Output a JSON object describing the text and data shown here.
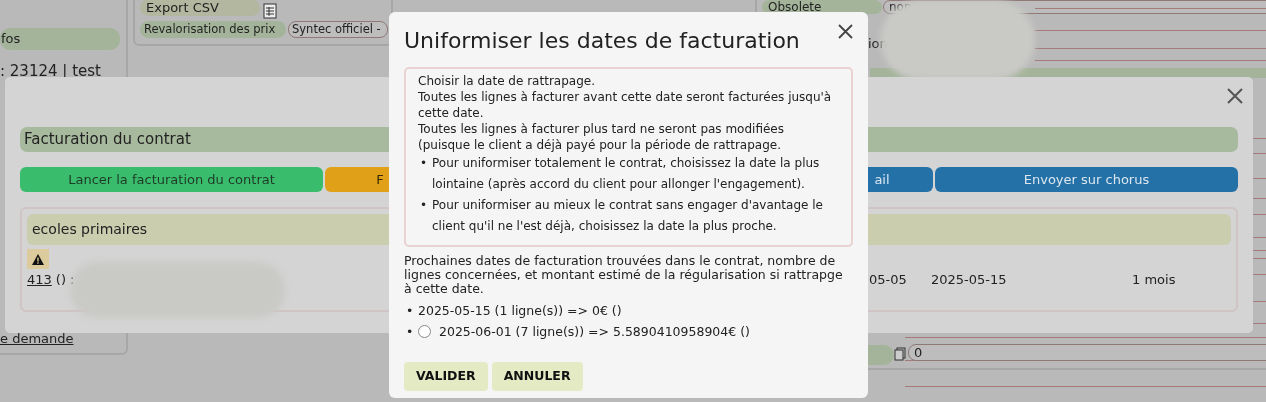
{
  "background": {
    "export_button": "Export CSV",
    "price_revaluation": {
      "label": "Revalorisation des prix",
      "value": "Syntec officiel -"
    },
    "section_header": "fos",
    "record_line": ": 23124 | test",
    "link": "e demande",
    "status": {
      "label": "Obsolete",
      "value": "non"
    },
    "fragment": "ion",
    "counter_value": "0"
  },
  "billing_dialog": {
    "header": "Facturation du contrat",
    "buttons": [
      {
        "label": "Lancer la facturation du contrat",
        "kind": "success"
      },
      {
        "label": "F",
        "kind": "warning"
      },
      {
        "label": "ail",
        "kind": "primary"
      },
      {
        "label": "Envoyer sur chorus",
        "kind": "primary"
      }
    ],
    "group": {
      "title": "ecoles primaires",
      "warning": true,
      "row": {
        "link": "413",
        "text": "() :",
        "cells": [
          "05-05",
          "2025-05-15",
          "1 mois"
        ]
      }
    }
  },
  "dialog": {
    "title": "Uniformiser les dates de facturation",
    "info": {
      "lines": [
        "Choisir la date de rattrapage.",
        "Toutes les lignes à facturer avant cette date seront facturées jusqu'à cette date.",
        "Toutes les lignes à facturer plus tard ne seront pas modifiées (puisque le client a déjà payé pour la période de rattrapage."
      ],
      "bullet_marker": "•",
      "bullets": [
        "Pour uniformiser totalement le contrat, choisissez la date la plus lointaine (après accord du client pour allonger l'engagement).",
        "Pour uniformiser au mieux le contrat sans engager d'avantage le client qu'il ne l'est déjà, choisissez la date la plus proche."
      ]
    },
    "intro": "Prochaines dates de facturation trouvées dans le contrat, nombre de lignes concernées, et montant estimé de la régularisation si rattrapge à cette date.",
    "option_marker": "•",
    "options": [
      {
        "label": "2025-05-15 (1 ligne(s)) => 0€ ()",
        "kind": "plain"
      },
      {
        "label": "2025-06-01 (7 ligne(s)) => 5.5890410958904€ ()",
        "kind": "radio",
        "selected": false
      }
    ],
    "buttons": [
      "VALIDER",
      "ANNULER"
    ]
  }
}
